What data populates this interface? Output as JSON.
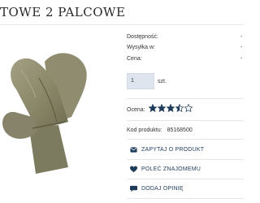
{
  "product": {
    "title": "TOWE 2 PALCOWE",
    "image_alt": "Rękawice",
    "code_label": "Kod produktu:",
    "code_value": "85168500",
    "rating_label": "Ocena:",
    "rating": 3.5,
    "rating_max": 5
  },
  "specs": [
    {
      "label": "Dostępność:",
      "value": "-"
    },
    {
      "label": "Wysyłka w:",
      "value": "-"
    },
    {
      "label": "Cena:",
      "value": "-"
    }
  ],
  "quantity": {
    "value": "1",
    "unit": "szt."
  },
  "actions": [
    {
      "label": "ZAPYTAJ O PRODUKT",
      "icon": "envelope-icon"
    },
    {
      "label": "POLEĆ ZNAJOMEMU",
      "icon": "heart-icon"
    },
    {
      "label": "DODAJ OPINIĘ",
      "icon": "comment-icon"
    }
  ],
  "colors": {
    "accent": "#1f3b5c",
    "star": "#1f3b5c",
    "qty_bg": "#dfe5ef",
    "glove": "#8c8a6c"
  }
}
